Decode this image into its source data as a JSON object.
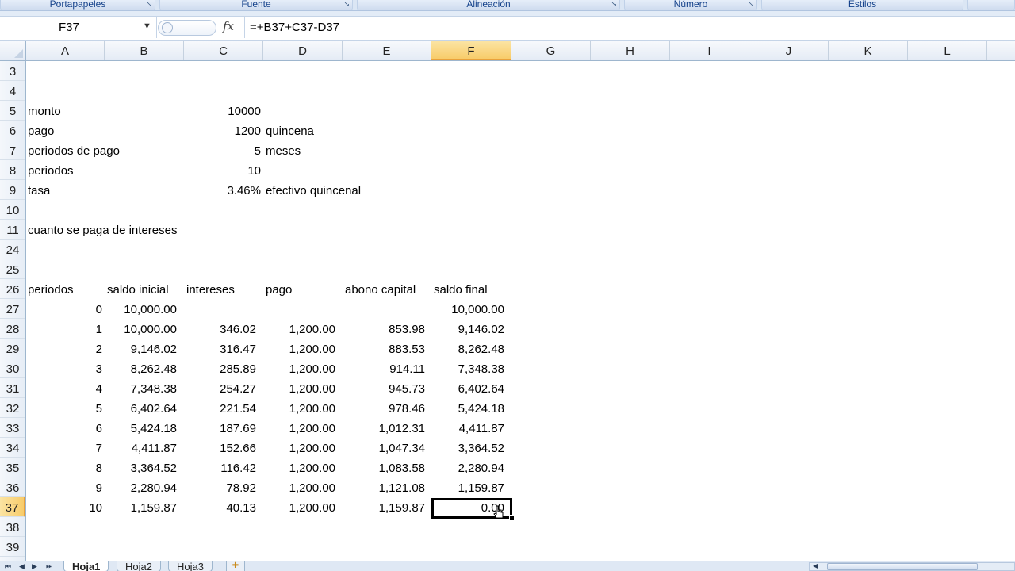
{
  "ribbon": {
    "groups": [
      {
        "label": "Portapapeles"
      },
      {
        "label": "Fuente"
      },
      {
        "label": "Alineación"
      },
      {
        "label": "Número"
      },
      {
        "label": "Estilos"
      }
    ]
  },
  "formula_bar": {
    "name_box": "F37",
    "fx_label": "fx",
    "formula": "=+B37+C37-D37"
  },
  "columns": [
    "A",
    "B",
    "C",
    "D",
    "E",
    "F",
    "G",
    "H",
    "I",
    "J",
    "K",
    "L"
  ],
  "selected_column": "F",
  "rows": [
    "3",
    "4",
    "5",
    "6",
    "7",
    "8",
    "9",
    "10",
    "11",
    "24",
    "25",
    "26",
    "27",
    "28",
    "29",
    "30",
    "31",
    "32",
    "33",
    "34",
    "35",
    "36",
    "37",
    "38",
    "39"
  ],
  "selected_row": "37",
  "params": [
    {
      "label": "monto",
      "value": "10000",
      "note": ""
    },
    {
      "label": "pago",
      "value": "1200",
      "note": "quincena"
    },
    {
      "label": "periodos de pago",
      "value": "5",
      "note": "meses"
    },
    {
      "label": "periodos",
      "value": "10",
      "note": ""
    },
    {
      "label": "tasa",
      "value": "3.46%",
      "note": "efectivo quincenal"
    }
  ],
  "question": "cuanto se paga de intereses",
  "table": {
    "headers": [
      "periodos",
      "saldo inicial",
      "intereses",
      "pago",
      "abono capital",
      "saldo final"
    ],
    "rows": [
      [
        "0",
        "10,000.00",
        "",
        "",
        "",
        "10,000.00"
      ],
      [
        "1",
        "10,000.00",
        "346.02",
        "1,200.00",
        "853.98",
        "9,146.02"
      ],
      [
        "2",
        "9,146.02",
        "316.47",
        "1,200.00",
        "883.53",
        "8,262.48"
      ],
      [
        "3",
        "8,262.48",
        "285.89",
        "1,200.00",
        "914.11",
        "7,348.38"
      ],
      [
        "4",
        "7,348.38",
        "254.27",
        "1,200.00",
        "945.73",
        "6,402.64"
      ],
      [
        "5",
        "6,402.64",
        "221.54",
        "1,200.00",
        "978.46",
        "5,424.18"
      ],
      [
        "6",
        "5,424.18",
        "187.69",
        "1,200.00",
        "1,012.31",
        "4,411.87"
      ],
      [
        "7",
        "4,411.87",
        "152.66",
        "1,200.00",
        "1,047.34",
        "3,364.52"
      ],
      [
        "8",
        "3,364.52",
        "116.42",
        "1,200.00",
        "1,083.58",
        "2,280.94"
      ],
      [
        "9",
        "2,280.94",
        "78.92",
        "1,200.00",
        "1,121.08",
        "1,159.87"
      ],
      [
        "10",
        "1,159.87",
        "40.13",
        "1,200.00",
        "1,159.87",
        "0.00"
      ]
    ]
  },
  "sheets": [
    {
      "label": "Hoja1",
      "active": true
    },
    {
      "label": "Hoja2",
      "active": false
    },
    {
      "label": "Hoja3",
      "active": false
    }
  ]
}
